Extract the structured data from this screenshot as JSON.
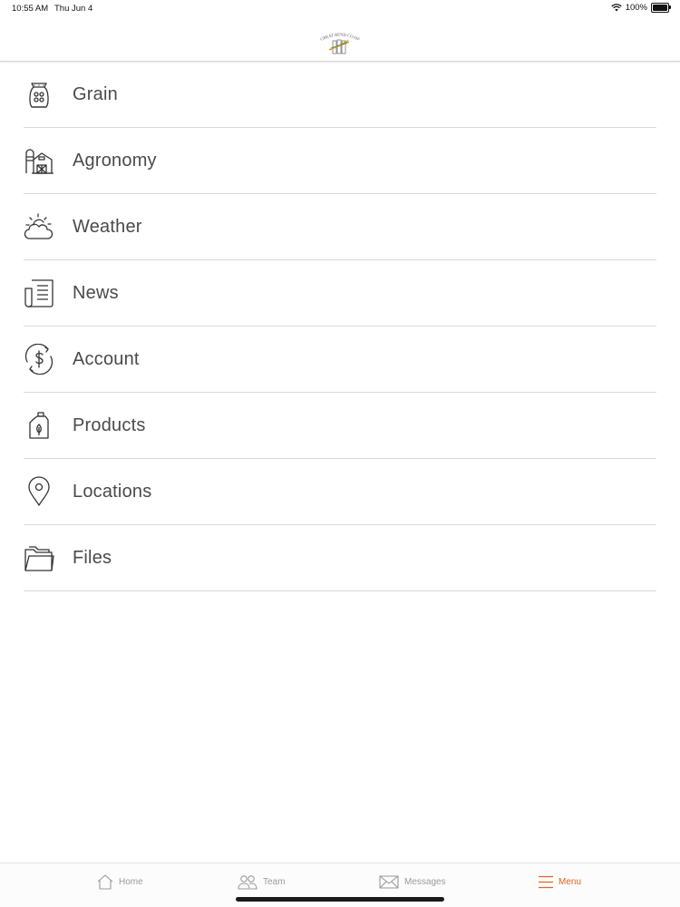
{
  "status_bar": {
    "time": "10:55 AM",
    "date": "Thu Jun 4",
    "battery": "100%"
  },
  "header": {
    "logo_text": "GREAT BEND CO-OP"
  },
  "menu": {
    "items": [
      {
        "label": "Grain",
        "icon": "grain-sack-icon"
      },
      {
        "label": "Agronomy",
        "icon": "barn-icon"
      },
      {
        "label": "Weather",
        "icon": "weather-icon"
      },
      {
        "label": "News",
        "icon": "newspaper-icon"
      },
      {
        "label": "Account",
        "icon": "dollar-icon"
      },
      {
        "label": "Products",
        "icon": "jug-icon"
      },
      {
        "label": "Locations",
        "icon": "map-pin-icon"
      },
      {
        "label": "Files",
        "icon": "folder-icon"
      }
    ]
  },
  "tab_bar": {
    "home": "Home",
    "team": "Team",
    "messages": "Messages",
    "menu": "Menu",
    "active": "Menu",
    "active_color": "#e0641f",
    "inactive_color": "#9a9a9a"
  }
}
